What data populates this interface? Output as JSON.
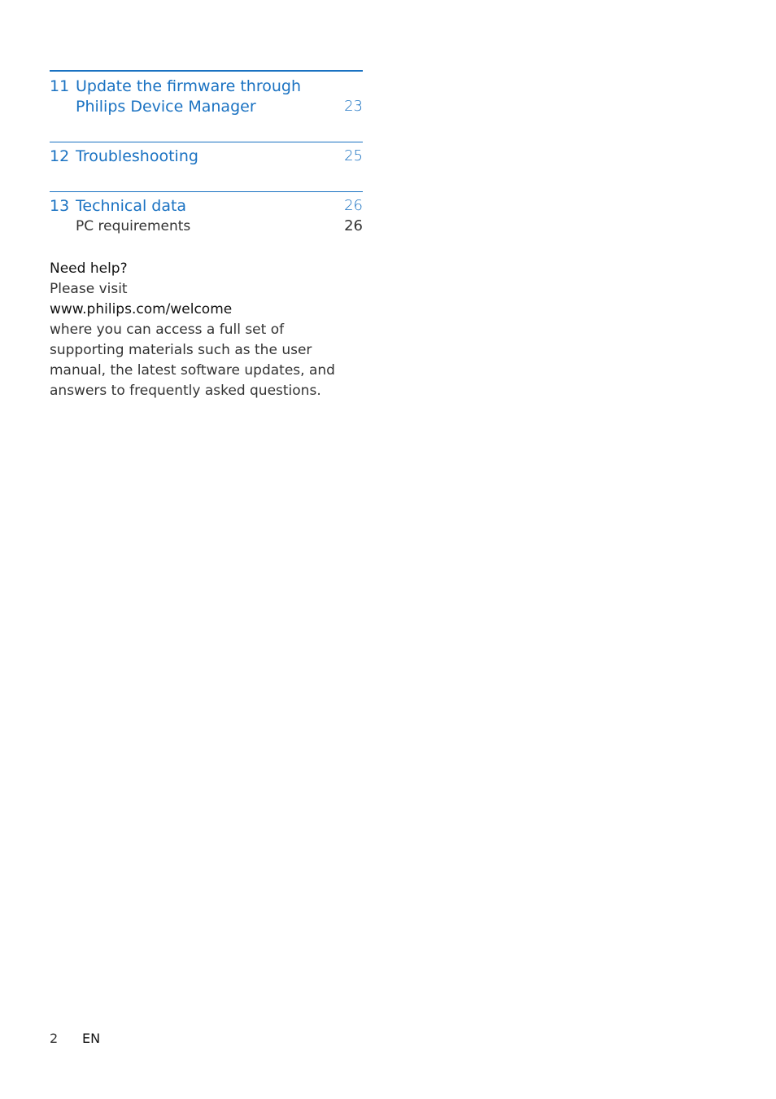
{
  "toc": {
    "sections": [
      {
        "number": "11",
        "title_line1": "Update the firmware through",
        "title_line2": "Philips Device Manager",
        "page": "23"
      },
      {
        "number": "12",
        "title": "Troubleshooting",
        "page": "25"
      },
      {
        "number": "13",
        "title": "Technical data",
        "page": "26",
        "subitems": [
          {
            "title": "PC requirements",
            "page": "26"
          }
        ]
      }
    ]
  },
  "help": {
    "heading": "Need help?",
    "line1": "Please visit",
    "url": "www.philips.com/welcome",
    "body": "where you can access a full set of supporting materials such as the user manual, the latest software updates, and answers to frequently asked questions."
  },
  "footer": {
    "page_number": "2",
    "language": "EN"
  },
  "colors": {
    "accent": "#1a72c2",
    "text": "#333333"
  }
}
